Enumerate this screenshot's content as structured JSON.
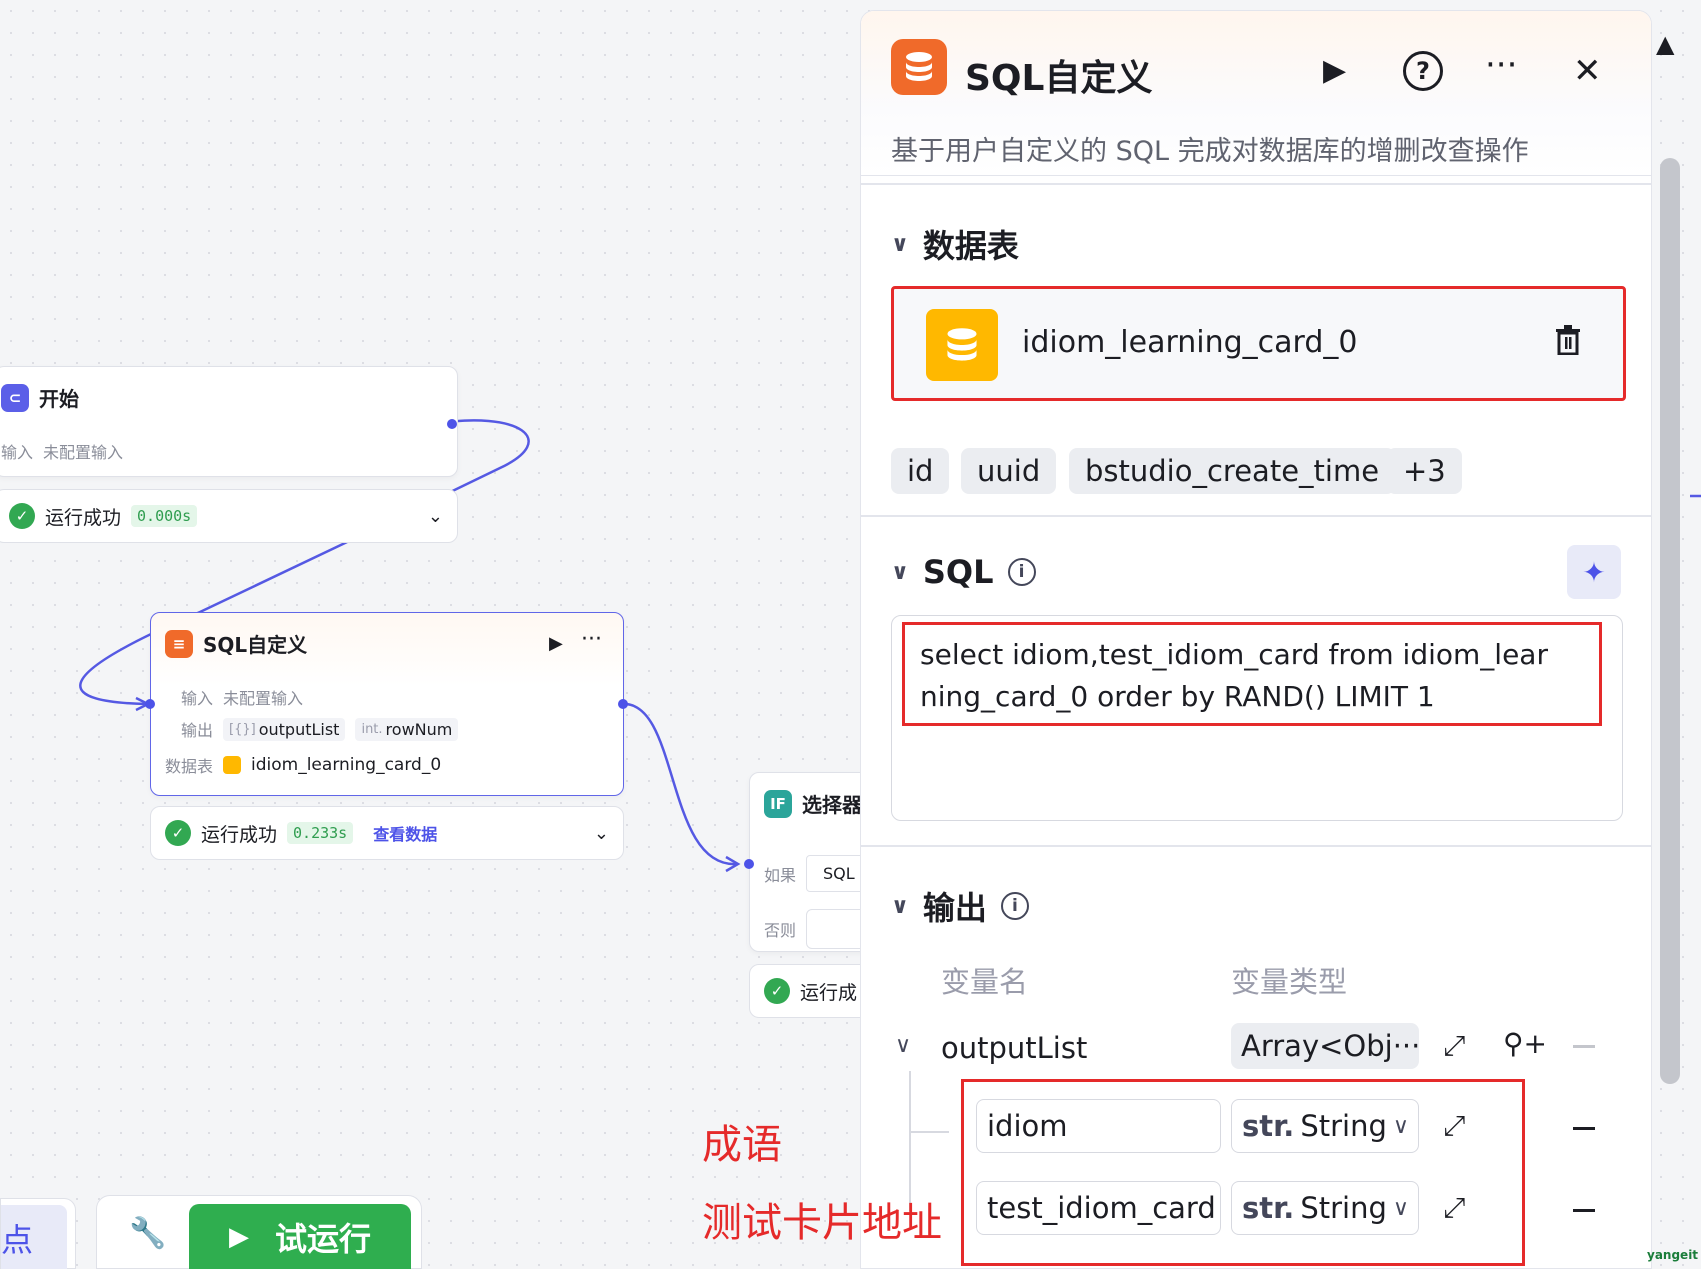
{
  "canvas": {
    "start_node": {
      "title": "开始",
      "input_label": "输入",
      "input_value": "未配置输入",
      "status": "运行成功",
      "duration": "0.000s"
    },
    "sql_node": {
      "title": "SQL自定义",
      "input_label": "输入",
      "input_value": "未配置输入",
      "output_label": "输出",
      "output_list_prefix": "[{}]",
      "output_list": "outputList",
      "output_num_prefix": "int.",
      "output_num": "rowNum",
      "table_label": "数据表",
      "table_value": "idiom_learning_card_0",
      "status": "运行成功",
      "duration": "0.233s",
      "view_data": "查看数据"
    },
    "selector_node": {
      "title": "选择器",
      "if_label": "如果",
      "if_value": "SQL",
      "else_label": "否则",
      "status": "运行成"
    }
  },
  "panel": {
    "title": "SQL自定义",
    "description": "基于用户自定义的 SQL 完成对数据库的增删改查操作",
    "table_section": {
      "title": "数据表",
      "table_name": "idiom_learning_card_0",
      "fields": [
        "id",
        "uuid",
        "bstudio_create_time",
        "+3"
      ]
    },
    "sql_section": {
      "title": "SQL",
      "query": "select idiom,test_idiom_card from idiom_learning_card_0 order by RAND() LIMIT 1"
    },
    "output_section": {
      "title": "输出",
      "col_name": "变量名",
      "col_type": "变量类型",
      "parent_name": "outputList",
      "parent_type": "Array<Obj···",
      "children": [
        {
          "name": "idiom",
          "type_prefix": "str.",
          "type": "String"
        },
        {
          "name": "test_idiom_card",
          "type_prefix": "str.",
          "type": "String"
        }
      ]
    }
  },
  "annotations": {
    "idiom": "成语",
    "card": "测试卡片地址"
  },
  "toolbar": {
    "left_label": "点",
    "run_label": "试运行"
  },
  "watermark": "yangeit",
  "colors": {
    "accent": "#4d53e8",
    "highlight_red": "#e52a2a",
    "success_green": "#2fae4f",
    "sql_orange": "#f06a2a",
    "table_yellow": "#ffb800"
  }
}
